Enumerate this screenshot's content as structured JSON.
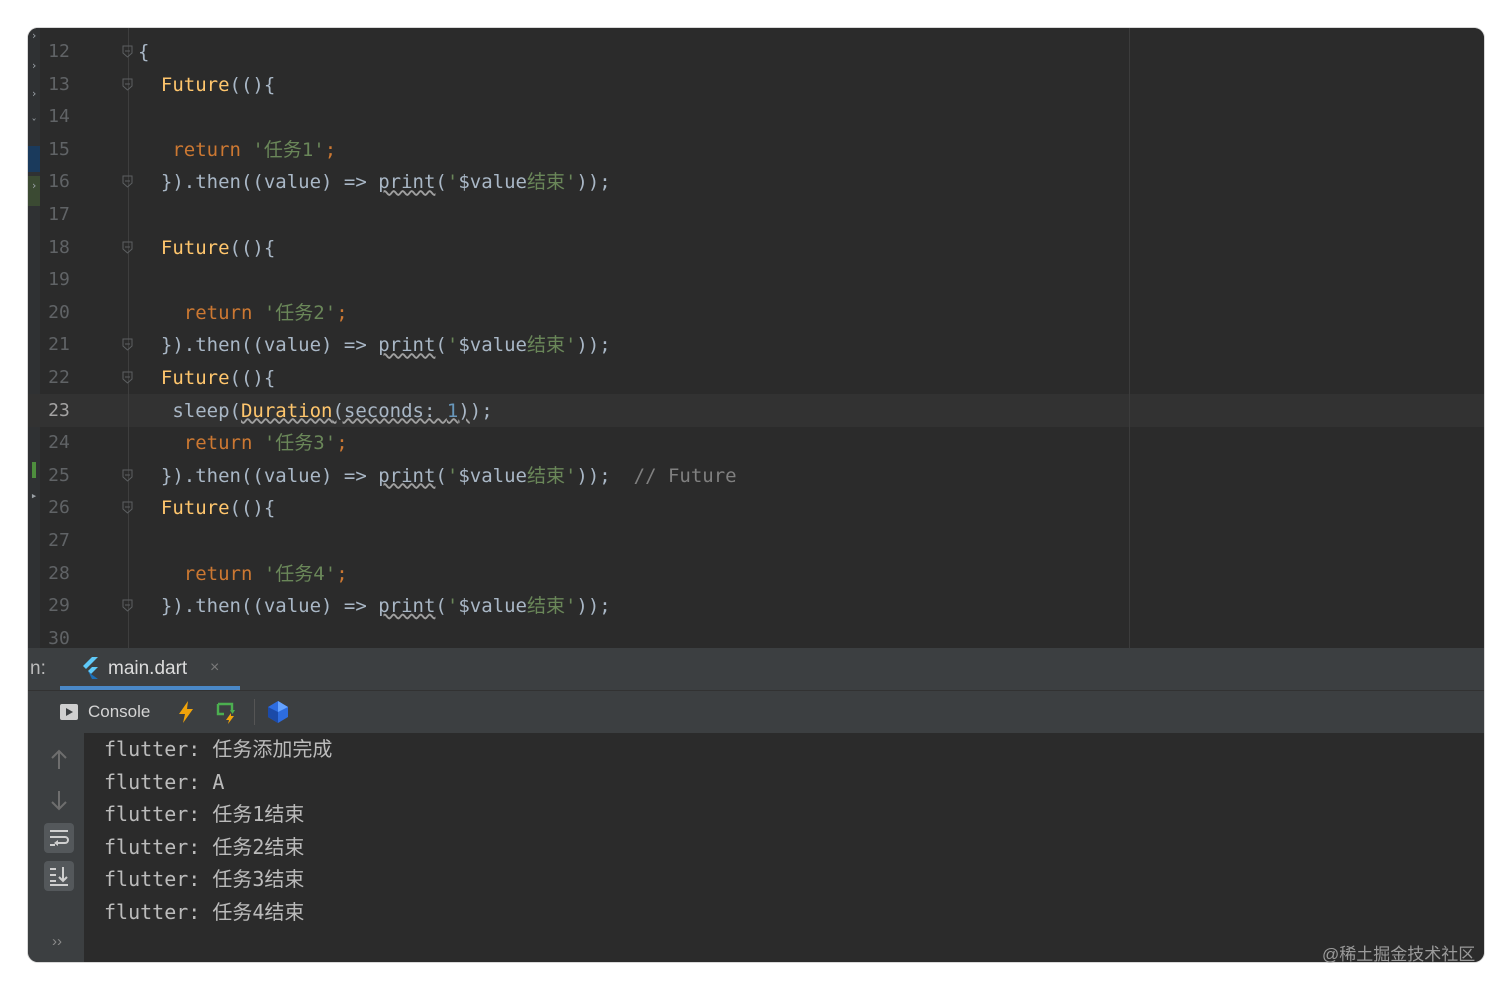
{
  "editor": {
    "current_line": "23",
    "lines": [
      {
        "num": "12",
        "tokens": [
          {
            "t": "{",
            "c": "p"
          }
        ]
      },
      {
        "num": "13",
        "tokens": [
          {
            "t": "  "
          },
          {
            "t": "Future",
            "c": "fn"
          },
          {
            "t": "(()"
          },
          {
            "t": "{"
          }
        ]
      },
      {
        "num": "14",
        "tokens": []
      },
      {
        "num": "15",
        "tokens": [
          {
            "t": "   "
          },
          {
            "t": "return",
            "c": "kw"
          },
          {
            "t": " "
          },
          {
            "t": "'任务1'",
            "c": "str"
          },
          {
            "t": ";",
            "c": "kw"
          }
        ]
      },
      {
        "num": "16",
        "tokens": [
          {
            "t": "  }).then((value) => "
          },
          {
            "t": "print",
            "c": "ul"
          },
          {
            "t": "("
          },
          {
            "t": "'",
            "c": "str"
          },
          {
            "t": "$value"
          },
          {
            "t": "结束'",
            "c": "str"
          },
          {
            "t": "));"
          },
          {
            "t": "",
            "c": "kw"
          }
        ]
      },
      {
        "num": "17",
        "tokens": []
      },
      {
        "num": "18",
        "tokens": [
          {
            "t": "  "
          },
          {
            "t": "Future",
            "c": "fn"
          },
          {
            "t": "(()"
          },
          {
            "t": "{"
          }
        ]
      },
      {
        "num": "19",
        "tokens": []
      },
      {
        "num": "20",
        "tokens": [
          {
            "t": "    "
          },
          {
            "t": "return",
            "c": "kw"
          },
          {
            "t": " "
          },
          {
            "t": "'任务2'",
            "c": "str"
          },
          {
            "t": ";",
            "c": "kw"
          }
        ]
      },
      {
        "num": "21",
        "tokens": [
          {
            "t": "  }).then((value) => "
          },
          {
            "t": "print",
            "c": "ul"
          },
          {
            "t": "("
          },
          {
            "t": "'",
            "c": "str"
          },
          {
            "t": "$value"
          },
          {
            "t": "结束'",
            "c": "str"
          },
          {
            "t": "));"
          }
        ]
      },
      {
        "num": "22",
        "tokens": [
          {
            "t": "  "
          },
          {
            "t": "Future",
            "c": "fn"
          },
          {
            "t": "(()"
          },
          {
            "t": "{"
          }
        ]
      },
      {
        "num": "23",
        "tokens": [
          {
            "t": "   sleep("
          },
          {
            "t": "Duration",
            "c": "fnul"
          },
          {
            "t": "(seconds: ",
            "c": "ul"
          },
          {
            "t": "1",
            "c": "numul"
          },
          {
            "t": ")",
            "c": "ul"
          },
          {
            "t": ");"
          }
        ]
      },
      {
        "num": "24",
        "tokens": [
          {
            "t": "    "
          },
          {
            "t": "return",
            "c": "kw"
          },
          {
            "t": " "
          },
          {
            "t": "'任务3'",
            "c": "str"
          },
          {
            "t": ";",
            "c": "kw"
          }
        ]
      },
      {
        "num": "25",
        "tokens": [
          {
            "t": "  }).then((value) => "
          },
          {
            "t": "print",
            "c": "ul"
          },
          {
            "t": "("
          },
          {
            "t": "'",
            "c": "str"
          },
          {
            "t": "$value"
          },
          {
            "t": "结束'",
            "c": "str"
          },
          {
            "t": "));"
          },
          {
            "t": "  // Future",
            "c": "cm"
          }
        ]
      },
      {
        "num": "26",
        "tokens": [
          {
            "t": "  "
          },
          {
            "t": "Future",
            "c": "fn"
          },
          {
            "t": "(()"
          },
          {
            "t": "{"
          }
        ]
      },
      {
        "num": "27",
        "tokens": []
      },
      {
        "num": "28",
        "tokens": [
          {
            "t": "    "
          },
          {
            "t": "return",
            "c": "kw"
          },
          {
            "t": " "
          },
          {
            "t": "'任务4'",
            "c": "str"
          },
          {
            "t": ";",
            "c": "kw"
          }
        ]
      },
      {
        "num": "29",
        "tokens": [
          {
            "t": "  }).then((value) => "
          },
          {
            "t": "print",
            "c": "ul"
          },
          {
            "t": "("
          },
          {
            "t": "'",
            "c": "str"
          },
          {
            "t": "$value"
          },
          {
            "t": "结束'",
            "c": "str"
          },
          {
            "t": "));"
          }
        ]
      },
      {
        "num": "30",
        "tokens": []
      }
    ]
  },
  "run_panel": {
    "prefix": "n:",
    "tab_label": "main.dart",
    "tab_close": "×",
    "console_label": "Console"
  },
  "console_output": [
    "flutter: 任务添加完成",
    "flutter: A",
    "flutter: 任务1结束",
    "flutter: 任务2结束",
    "flutter: 任务3结束",
    "flutter: 任务4结束"
  ],
  "side_more": "››",
  "watermark": "@稀土掘金技术社区",
  "colors": {
    "keyword": "#cc7832",
    "function": "#ffc66d",
    "string": "#6a8759",
    "comment": "#808080",
    "number": "#6897bb",
    "text": "#a9b7c6",
    "background": "#2b2b2b"
  }
}
